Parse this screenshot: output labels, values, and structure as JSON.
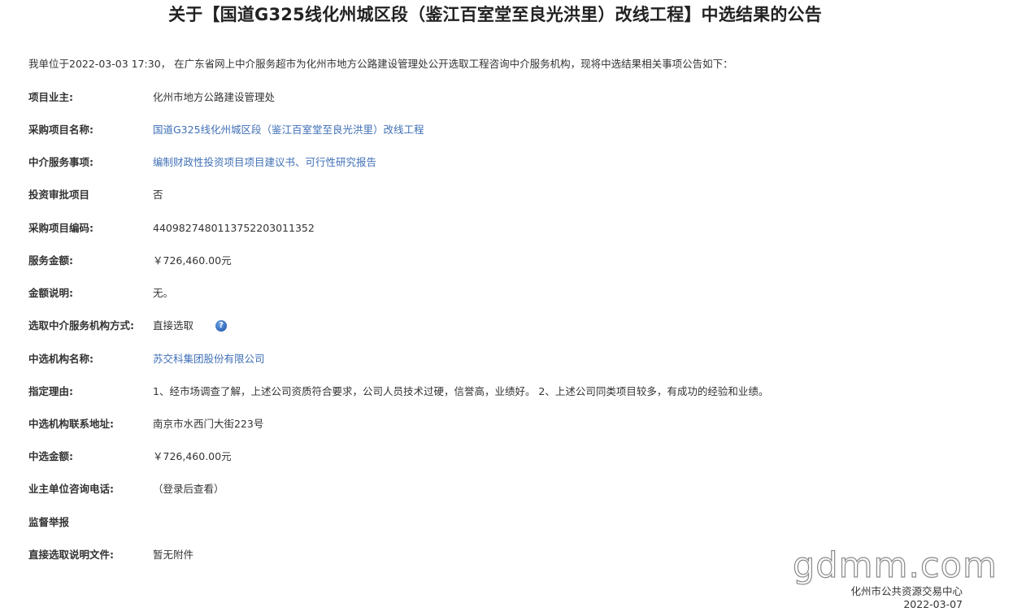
{
  "title": "关于【国道G325线化州城区段（鉴江百室堂至良光洪里）改线工程】中选结果的公告",
  "intro": "我单位于2022-03-03 17:30， 在广东省网上中介服务超市为化州市地方公路建设管理处公开选取工程咨询中介服务机构，现将中选结果相关事项公告如下：",
  "fields": [
    {
      "label": "项目业主:",
      "value": "化州市地方公路建设管理处"
    },
    {
      "label": "采购项目名称:",
      "value": "国道G325线化州城区段（鉴江百室堂至良光洪里）改线工程"
    },
    {
      "label": "中介服务事项:",
      "value": "编制财政性投资项目项目建议书、可行性研究报告"
    },
    {
      "label": "投资审批项目",
      "value": "否"
    },
    {
      "label": "采购项目编码:",
      "value": "44098274801137522030113​52"
    },
    {
      "label": "服务金额:",
      "value": "￥726,460.00元"
    },
    {
      "label": "金额说明:",
      "value": "无。"
    },
    {
      "label": "选取中介服务机构方式:",
      "value": "直接选取"
    },
    {
      "label": "中选机构名称:",
      "value": "苏交科集团股份有限公司"
    },
    {
      "label": "指定理由:",
      "value": "1、经市场调查了解，上述公司资质符合要求，公司人员技术过硬，信誉高，业绩好。 2、上述公司同类项目较多，有成功的经验和业绩。"
    },
    {
      "label": "中选机构联系地址:",
      "value": "南京市水西门大街223号"
    },
    {
      "label": "中选金额:",
      "value": "￥726,460.00元"
    },
    {
      "label": "业主单位咨询电话:",
      "value": "（登录后查看）"
    },
    {
      "label": "监督举报",
      "value": ""
    },
    {
      "label": "直接选取说明文件:",
      "value": "暂无附件"
    }
  ],
  "help_icon": {
    "name": "question-help-icon",
    "glyph": "?"
  },
  "watermark": "gdmm.com",
  "footer": {
    "org": "化州市公共资源交易中心",
    "date": "2022-03-07"
  }
}
